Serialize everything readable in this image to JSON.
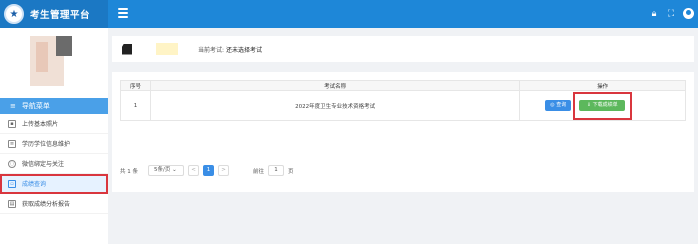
{
  "app": {
    "title": "考生管理平台"
  },
  "header": {
    "icons": [
      "lock-icon",
      "fullscreen-icon",
      "user-icon"
    ]
  },
  "sidebar": {
    "nav_title": "导航菜单",
    "items": [
      {
        "label": "上传基本照片",
        "icon": "photo-icon"
      },
      {
        "label": "学历学位信息维护",
        "icon": "edit-icon"
      },
      {
        "label": "微信绑定与关注",
        "icon": "wechat-icon"
      },
      {
        "label": "成绩查询",
        "icon": "search-doc-icon",
        "active": true
      },
      {
        "label": "获取成绩分析报告",
        "icon": "report-icon"
      }
    ]
  },
  "exam": {
    "label": "当前考试:",
    "value": "还未选择考试"
  },
  "table": {
    "headers": [
      "序号",
      "考试名称",
      "操作"
    ],
    "rows": [
      {
        "no": "1",
        "name": "2022年度卫生专业技术资格考试"
      }
    ],
    "view_button": "◎ 查询",
    "download_button": "⇓ 下载成绩单"
  },
  "pager": {
    "total": "共 1 条",
    "page_size": "5条/页 ⌄",
    "prev": "<",
    "current": "1",
    "next": ">",
    "goto_label": "前往",
    "goto_value": "1",
    "goto_suffix": "页"
  },
  "colors": {
    "topbar": "#1e87d8",
    "accent": "#3a8ee6",
    "success": "#5cb85c",
    "highlight": "#d9363e"
  }
}
